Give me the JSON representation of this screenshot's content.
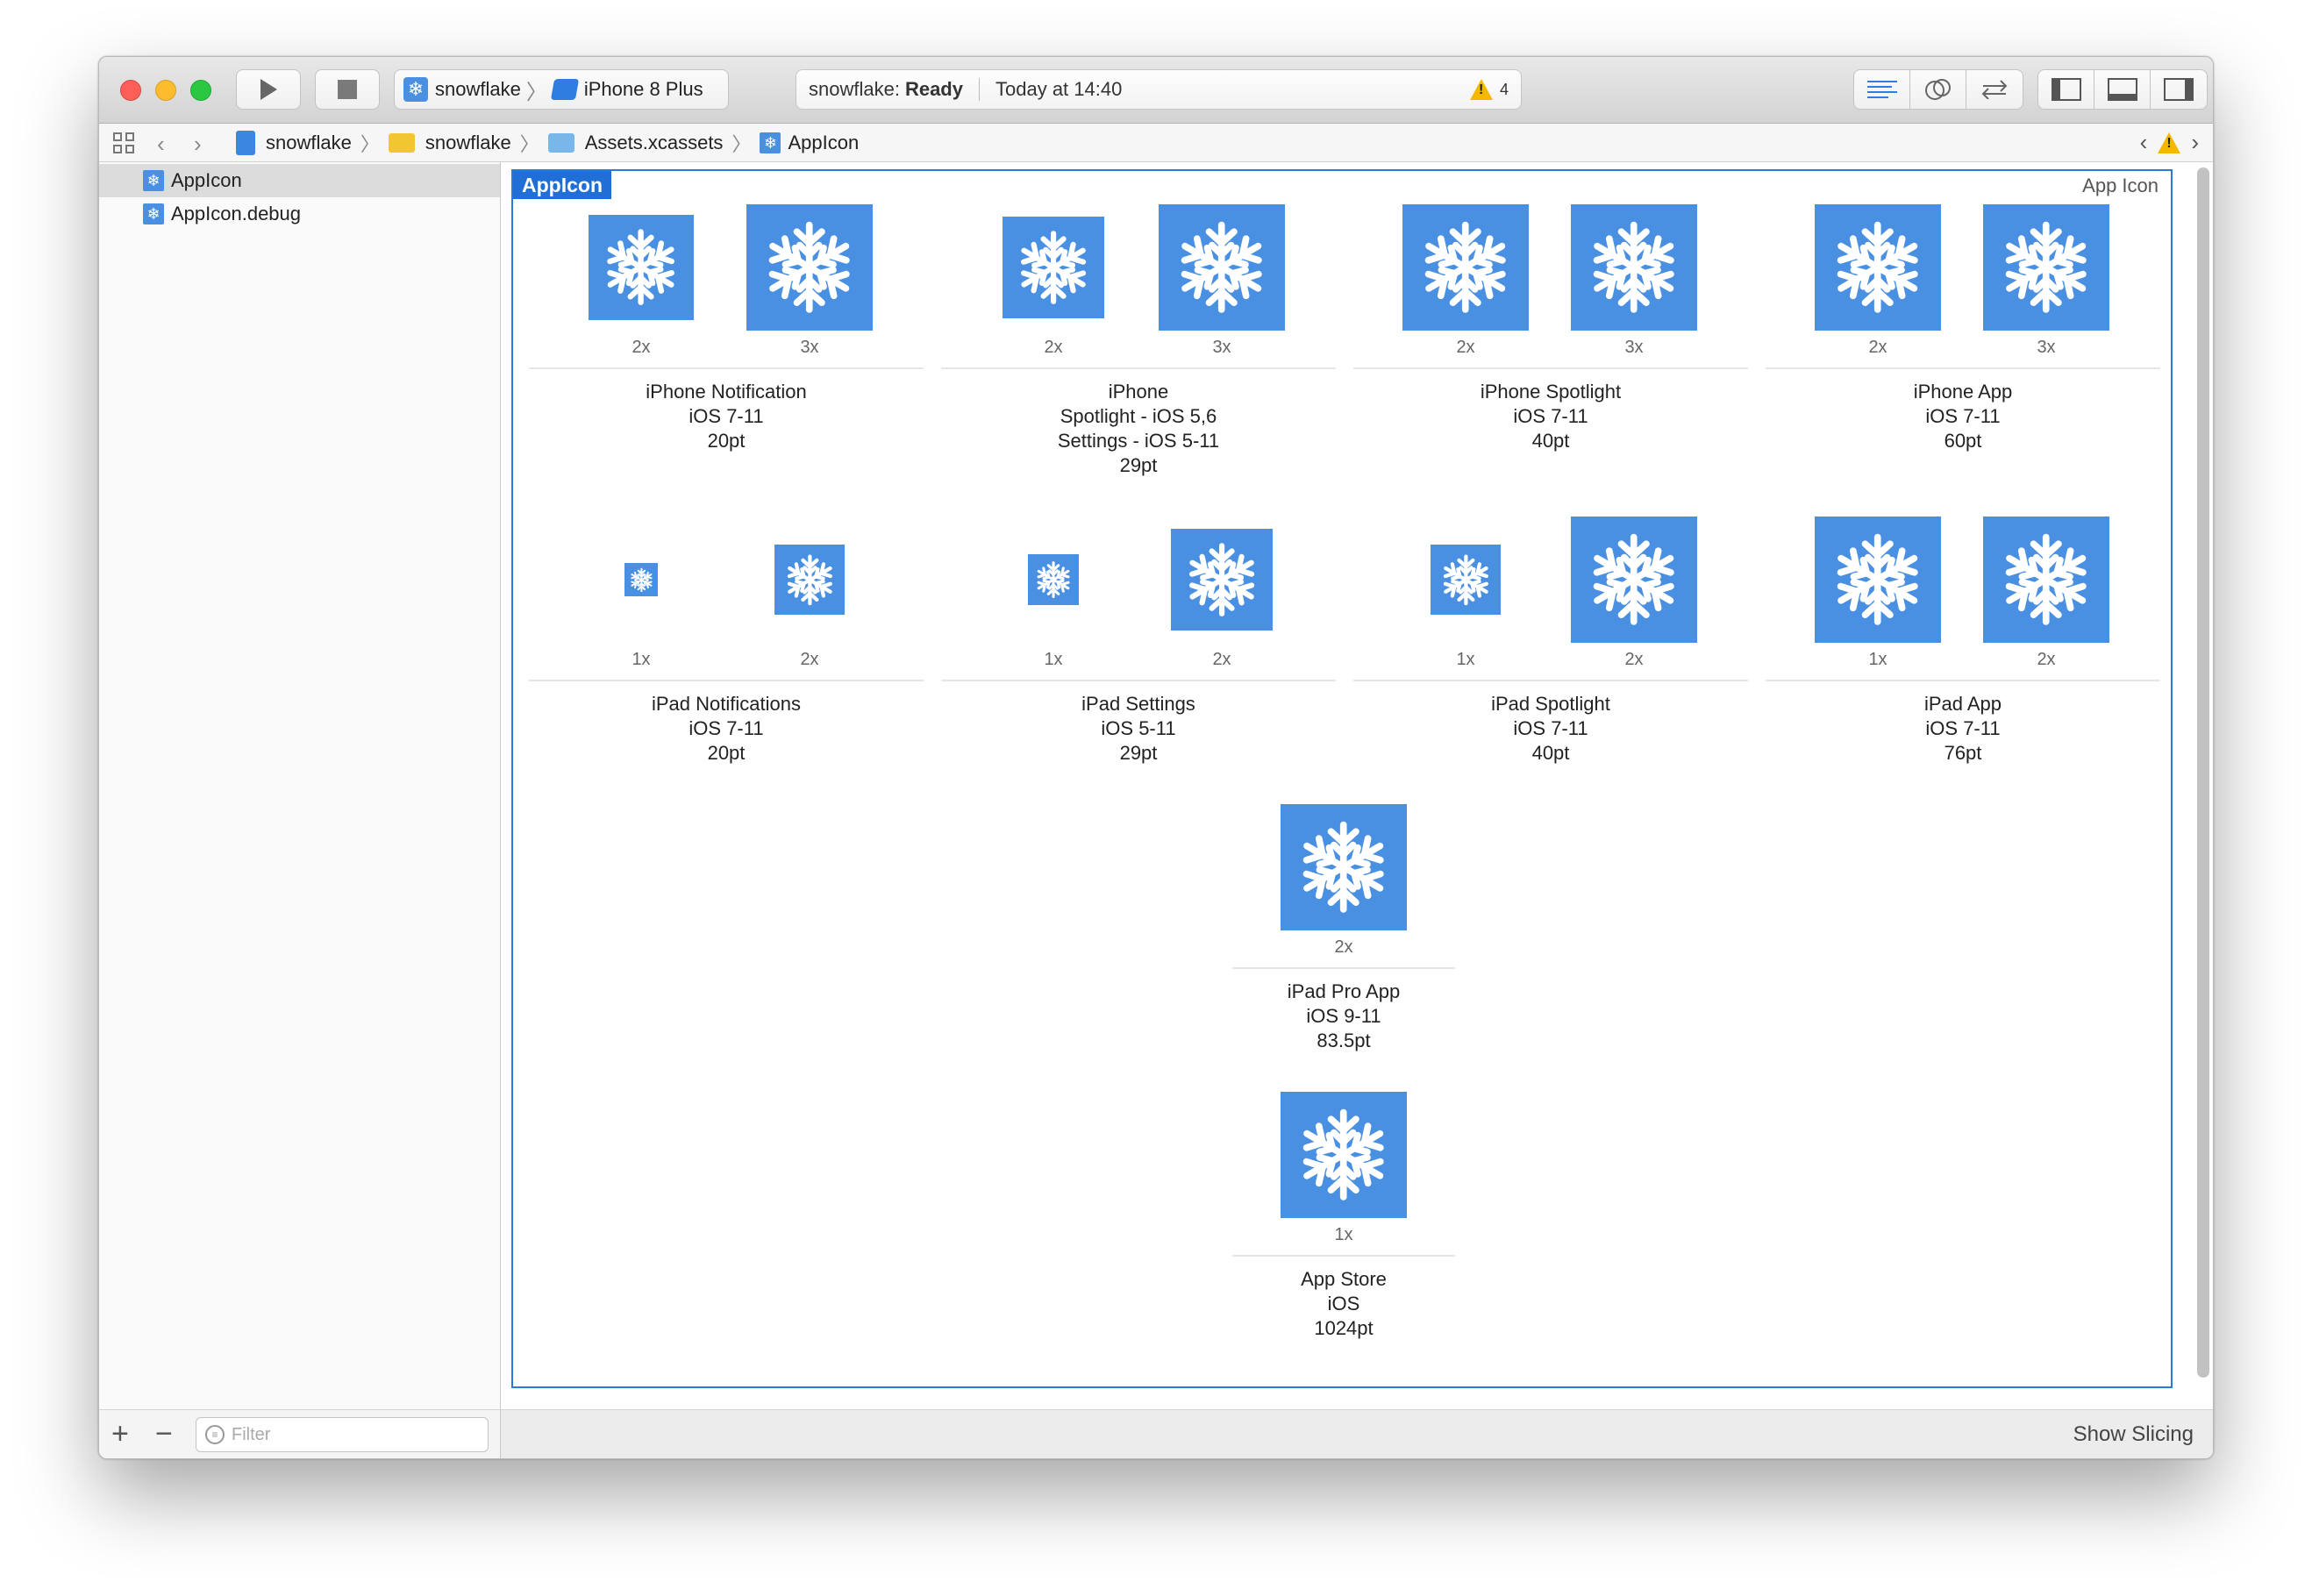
{
  "toolbar": {
    "scheme_name": "snowflake",
    "device_name": "iPhone 8 Plus",
    "activity_project": "snowflake:",
    "activity_status": "Ready",
    "activity_time": "Today at 14:40",
    "warning_count": "4"
  },
  "jumpbar": {
    "crumbs": [
      "snowflake",
      "snowflake",
      "Assets.xcassets",
      "AppIcon"
    ]
  },
  "sidebar": {
    "items": [
      {
        "label": "AppIcon"
      },
      {
        "label": "AppIcon.debug"
      }
    ],
    "filter_placeholder": "Filter"
  },
  "asset_set": {
    "name": "AppIcon",
    "type": "App Icon"
  },
  "groups": [
    {
      "title_lines": [
        "iPhone Notification",
        "iOS 7-11",
        "20pt"
      ],
      "scales": [
        "2x",
        "3x"
      ]
    },
    {
      "title_lines": [
        "iPhone",
        "Spotlight - iOS 5,6",
        "Settings - iOS 5-11",
        "29pt"
      ],
      "scales": [
        "2x",
        "3x"
      ]
    },
    {
      "title_lines": [
        "iPhone Spotlight",
        "iOS 7-11",
        "40pt"
      ],
      "scales": [
        "2x",
        "3x"
      ]
    },
    {
      "title_lines": [
        "iPhone App",
        "iOS 7-11",
        "60pt"
      ],
      "scales": [
        "2x",
        "3x"
      ]
    },
    {
      "title_lines": [
        "iPad Notifications",
        "iOS 7-11",
        "20pt"
      ],
      "scales": [
        "1x",
        "2x"
      ]
    },
    {
      "title_lines": [
        "iPad Settings",
        "iOS 5-11",
        "29pt"
      ],
      "scales": [
        "1x",
        "2x"
      ]
    },
    {
      "title_lines": [
        "iPad Spotlight",
        "iOS 7-11",
        "40pt"
      ],
      "scales": [
        "1x",
        "2x"
      ]
    },
    {
      "title_lines": [
        "iPad App",
        "iOS 7-11",
        "76pt"
      ],
      "scales": [
        "1x",
        "2x"
      ]
    },
    {
      "title_lines": [
        "iPad Pro App",
        "iOS 9-11",
        "83.5pt"
      ],
      "scales": [
        "2x"
      ]
    },
    {
      "title_lines": [
        "App Store",
        "iOS",
        "1024pt"
      ],
      "scales": [
        "1x"
      ]
    }
  ],
  "footer": {
    "show_slicing": "Show Slicing"
  },
  "icons": {
    "tile": "snowflake-icon",
    "color": "#4A90E2"
  }
}
